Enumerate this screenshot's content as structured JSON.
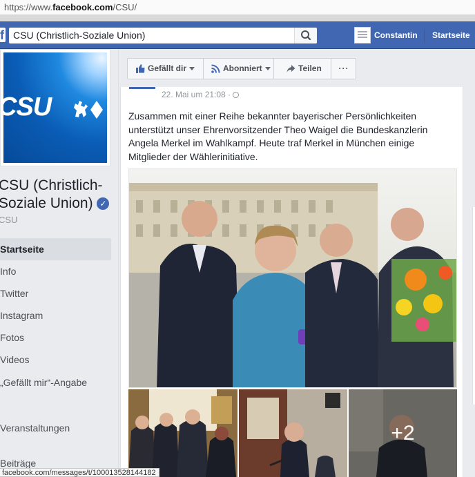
{
  "browser": {
    "url_prefix": "https://www.",
    "url_domain": "facebook.com",
    "url_path": "/CSU/"
  },
  "topbar": {
    "search_value": "CSU (Christlich-Soziale Union)",
    "user_name": "Constantin",
    "home_label": "Startseite",
    "logo_letter": "f"
  },
  "page": {
    "cover_text": "CSU",
    "name": "CSU (Christlich-Soziale Union)",
    "handle": "CSU",
    "brand_color": "#1f89e0"
  },
  "nav": {
    "items": [
      {
        "label": "Startseite",
        "active": true
      },
      {
        "label": "Info"
      },
      {
        "label": "Twitter"
      },
      {
        "label": "Instagram"
      },
      {
        "label": "Fotos"
      },
      {
        "label": "Videos"
      },
      {
        "label": "„Gefällt mir“-Angabe"
      },
      {
        "label": "Veranstaltungen"
      },
      {
        "label": "Beiträge"
      }
    ]
  },
  "actions": {
    "like": "Gefällt dir",
    "follow": "Abonniert",
    "share": "Teilen",
    "more": "···"
  },
  "post": {
    "timestamp": "22. Mai um 21:08 ·",
    "text": "Zusammen mit einer Reihe bekannter bayerischer Persönlichkeiten unterstützt unser Ehrenvorsitzender Theo Waigel die Bundeskanzlerin Angela Merkel im Wahlkampf. Heute traf Merkel in München einige Mitglieder der Wählerinitiative.",
    "more_photos": "+2"
  },
  "statusbar": {
    "link": "facebook.com/messages/t/100013528144182"
  },
  "colors": {
    "fb_blue": "#4267b2",
    "bg": "#e9ebee"
  }
}
